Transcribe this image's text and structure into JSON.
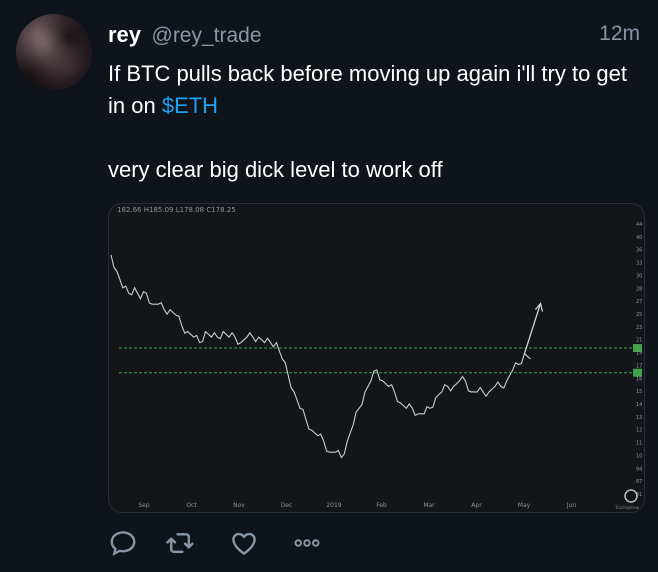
{
  "tweet": {
    "display_name": "rey",
    "handle": "@rey_trade",
    "time": "12m",
    "text_before": "If BTC pulls back before moving up again i'll try to get in on ",
    "cashtag": "$ETH",
    "text_after": "\n\nvery clear big dick level to work off"
  },
  "chart_data": {
    "type": "line",
    "title": "",
    "ohlc_readout": "182.66 H185.09 L178.08 C178.25",
    "x_ticks": [
      "Sep",
      "Oct",
      "Nov",
      "Dec",
      "2019",
      "Feb",
      "Mar",
      "Apr",
      "May",
      "Jun"
    ],
    "y_ticks": [
      "44",
      "40",
      "36",
      "33",
      "30",
      "28",
      "27",
      "25",
      "23",
      "21",
      "19",
      "17",
      "16",
      "15",
      "14",
      "13",
      "12",
      "11",
      "10",
      "94",
      "87",
      "81"
    ],
    "series": [
      {
        "values": [
          44,
          41,
          38,
          37,
          38,
          36,
          37,
          35,
          35,
          34,
          34,
          33,
          31,
          30,
          29,
          28,
          30,
          29,
          29,
          30,
          29,
          29,
          28,
          29,
          29,
          29,
          28,
          28,
          28,
          25,
          22,
          19,
          16,
          14,
          12,
          11,
          10,
          8,
          8,
          7,
          10,
          13,
          16,
          19,
          21,
          23,
          21,
          20,
          19,
          17,
          16,
          16,
          15,
          15,
          16,
          18,
          19,
          20,
          20,
          21,
          21,
          19,
          19,
          19,
          19,
          20,
          20,
          21,
          23,
          24,
          26,
          25
        ]
      }
    ],
    "levels": [
      {
        "value": 27,
        "label": "27",
        "color": "#3fa34d"
      },
      {
        "value": 22.5,
        "label": "19",
        "color": "#3fa34d"
      }
    ],
    "arrow": {
      "from_index": 70,
      "direction": "up"
    },
    "ylim": [
      0,
      50
    ],
    "grid": false,
    "watermark": "TradingView"
  },
  "actions": {
    "reply": "reply-icon",
    "retweet": "retweet-icon",
    "like": "heart-icon",
    "more": "more-icon"
  },
  "colors": {
    "background": "#0f141a",
    "cashtag": "#1da1f2",
    "muted": "#8a96a3",
    "level_line": "#3fa34d"
  }
}
